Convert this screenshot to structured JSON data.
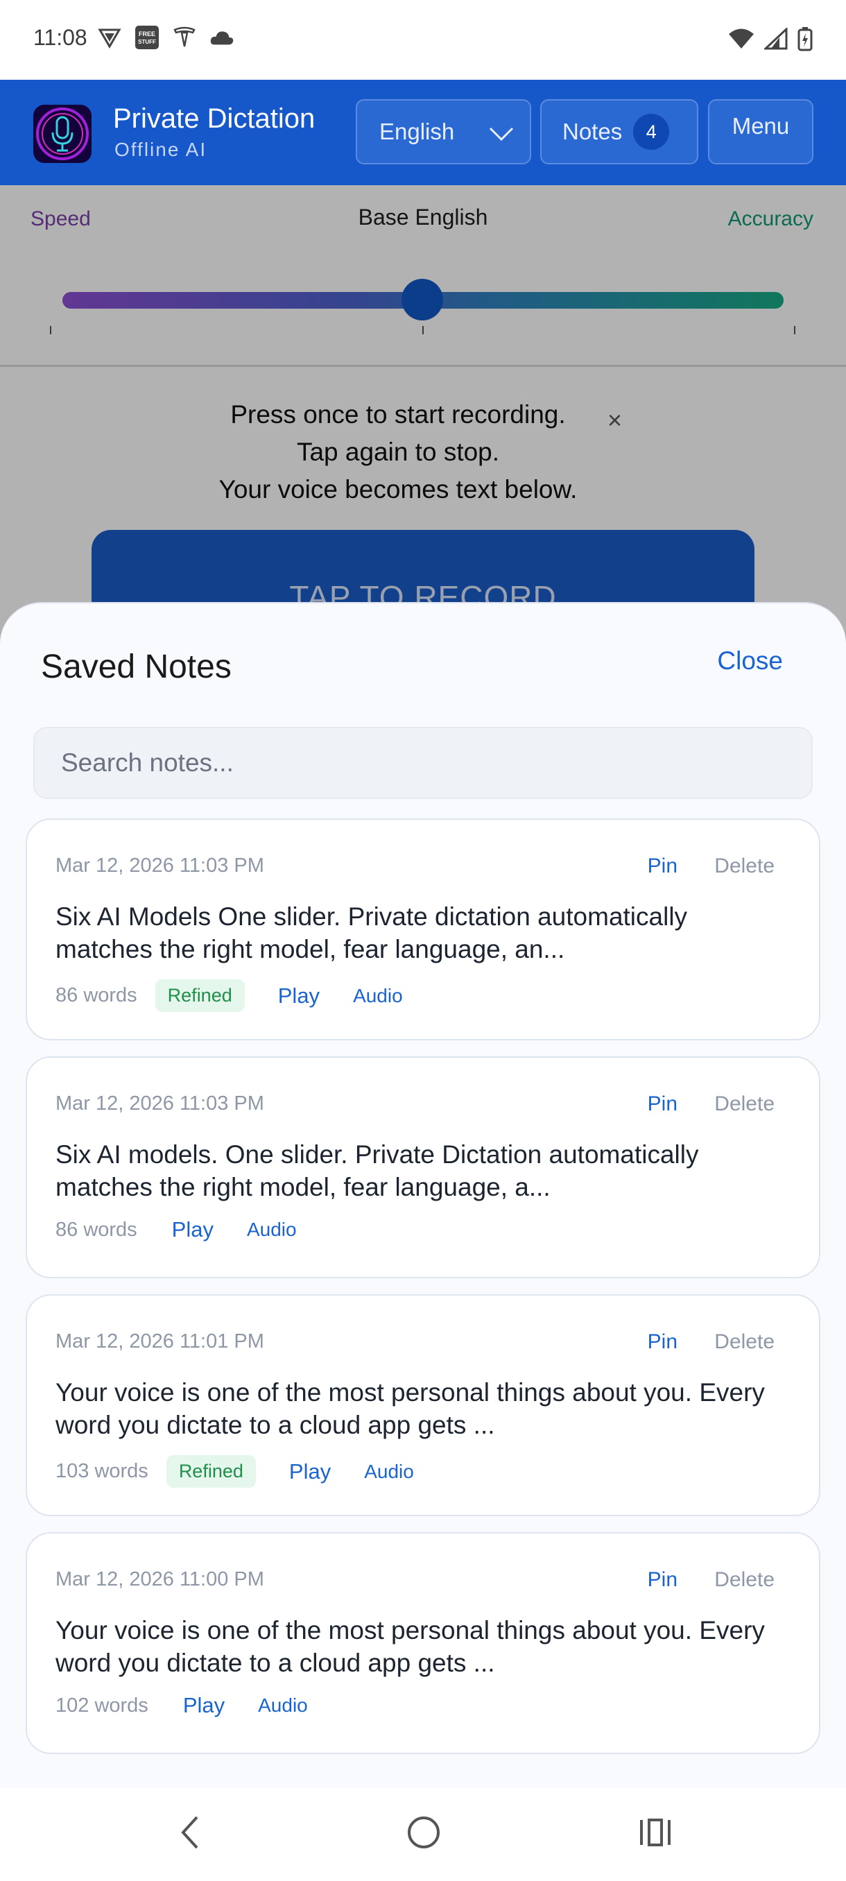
{
  "status_bar": {
    "time": "11:08",
    "left_icons": [
      "vpn-shield-icon",
      "free-stuff-icon",
      "tesla-icon",
      "cloud-icon"
    ],
    "right_icons": [
      "wifi-icon",
      "signal-icon",
      "battery-icon"
    ],
    "free_stuff_label": "FREE STUFF"
  },
  "header": {
    "app_name": "Private Dictation",
    "app_subtitle": "Offline AI",
    "language": "English",
    "notes_label": "Notes",
    "notes_count": "4",
    "menu_label": "Menu",
    "brand_color": "#1658c9"
  },
  "model_slider": {
    "left_label": "Speed",
    "current_model": "Base English",
    "right_label": "Accuracy",
    "position_fraction": 0.5
  },
  "instructions": {
    "line1": "Press once  to start recording.",
    "line2": "Tap again to stop.",
    "line3": "Your voice becomes text below.",
    "dismiss": "×"
  },
  "record_button": {
    "label": "TAP TO RECORD"
  },
  "notes_sheet": {
    "title": "Saved Notes",
    "close_label": "Close",
    "search_placeholder": "Search notes...",
    "notes": [
      {
        "date": "Mar 12, 2026  11:03 PM",
        "pin": "Pin",
        "delete": "Delete",
        "text": "Six AI Models One slider. Private dictation automatically matches the right model, fear language, an...",
        "words": "86 words",
        "refined": "Refined",
        "play": "Play",
        "audio": "Audio"
      },
      {
        "date": "Mar 12, 2026  11:03 PM",
        "pin": "Pin",
        "delete": "Delete",
        "text": "Six AI models. One slider. Private Dictation automatically matches the right model, fear language, a...",
        "words": "86 words",
        "play": "Play",
        "audio": "Audio"
      },
      {
        "date": "Mar 12, 2026  11:01 PM",
        "pin": "Pin",
        "delete": "Delete",
        "text": "Your voice is one of the most personal things about you. Every word you dictate to a cloud app gets ...",
        "words": "103 words",
        "refined": "Refined",
        "play": "Play",
        "audio": "Audio"
      },
      {
        "date": "Mar 12, 2026  11:00 PM",
        "pin": "Pin",
        "delete": "Delete",
        "text": "Your voice is one of the most personal things about you. Every word you dictate to a cloud app gets ...",
        "words": "102 words",
        "play": "Play",
        "audio": "Audio"
      }
    ]
  },
  "nav_bar": {
    "icons": [
      "back-icon",
      "home-icon",
      "recents-icon"
    ]
  }
}
